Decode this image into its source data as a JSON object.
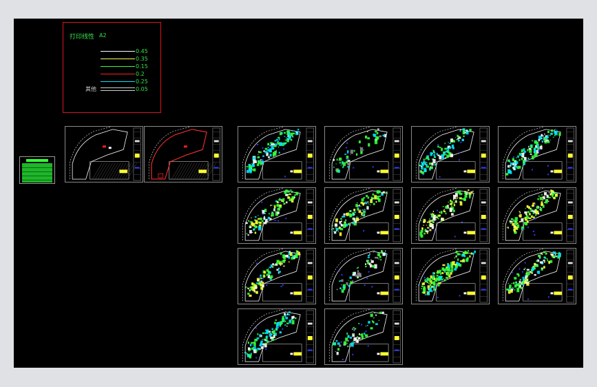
{
  "legend": {
    "title": "打印线性",
    "paper": "A2",
    "rows": [
      {
        "value": "0.45",
        "color": "#ffffff"
      },
      {
        "value": "0.35",
        "color": "#ffff66"
      },
      {
        "value": "0.15",
        "color": "#35ff3c"
      },
      {
        "value": "0.2",
        "color": "#ff2020"
      },
      {
        "value": "0.25",
        "color": "#00e5ff"
      },
      {
        "value": "0.05",
        "color": "#cfcfcf",
        "label": "其他"
      }
    ]
  },
  "sheets": [
    {
      "id": "cover-sheet",
      "kind": "cover"
    },
    {
      "id": "sheet-original-plan",
      "kind": "base"
    },
    {
      "id": "sheet-demolition-plan",
      "kind": "demo"
    },
    {
      "id": "sheet-r1c1",
      "kind": "dense",
      "fill": "cyan"
    },
    {
      "id": "sheet-r1c2",
      "kind": "dense",
      "fill": "sparse"
    },
    {
      "id": "sheet-r1c3",
      "kind": "dense",
      "fill": "cyan"
    },
    {
      "id": "sheet-r1c4",
      "kind": "dense",
      "fill": "cyan"
    },
    {
      "id": "sheet-r2c1",
      "kind": "dense",
      "fill": "mixed"
    },
    {
      "id": "sheet-r2c2",
      "kind": "dense",
      "fill": "green"
    },
    {
      "id": "sheet-r2c3",
      "kind": "dense",
      "fill": "yellow"
    },
    {
      "id": "sheet-r2c4",
      "kind": "dense",
      "fill": "yellow"
    },
    {
      "id": "sheet-r3c1",
      "kind": "dense",
      "fill": "green"
    },
    {
      "id": "sheet-r3c2",
      "kind": "dense",
      "fill": "sparse"
    },
    {
      "id": "sheet-r3c3",
      "kind": "dense",
      "fill": "solidgreen"
    },
    {
      "id": "sheet-r3c4",
      "kind": "dense",
      "fill": "green"
    },
    {
      "id": "sheet-r4c1",
      "kind": "dense",
      "fill": "cyan"
    },
    {
      "id": "sheet-r4c2",
      "kind": "dense",
      "fill": "sparse"
    }
  ],
  "colors": {
    "background": "#000000",
    "frame": "#dfe1e4",
    "green": "#35ff3c",
    "cyan": "#00e5ff",
    "yellow": "#ffff33",
    "red": "#ff2020",
    "blue": "#2f3cff"
  }
}
